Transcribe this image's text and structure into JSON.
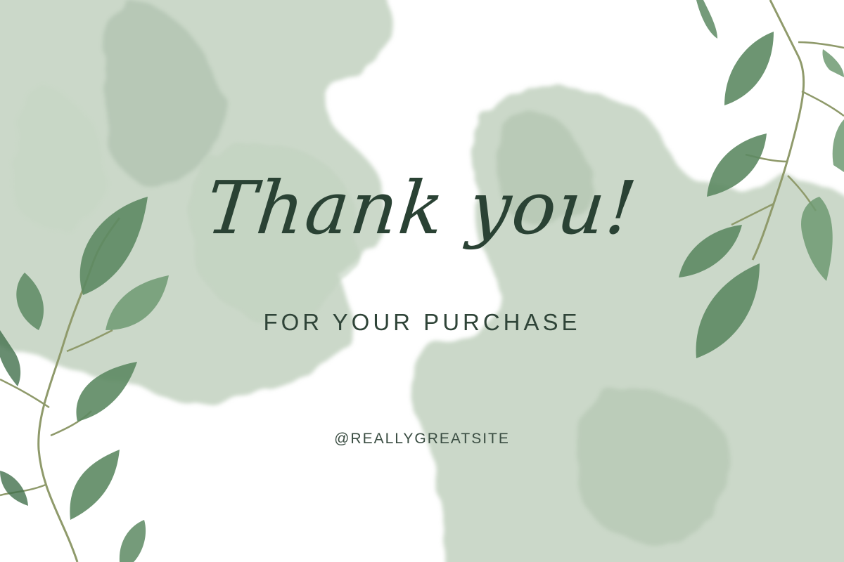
{
  "card": {
    "headline": "Thank you!",
    "subline": "FOR YOUR PURCHASE",
    "handle": "@REALLYGREATSITE"
  },
  "colors": {
    "watercolor": "#a9bfa9",
    "leaf": "#5d8a63",
    "leaf_dark": "#42704c",
    "stem": "#8f9a6b",
    "text": "#2a4234"
  },
  "decor": {
    "leaves_left": "eucalyptus-branch",
    "leaves_right": "eucalyptus-branch"
  }
}
